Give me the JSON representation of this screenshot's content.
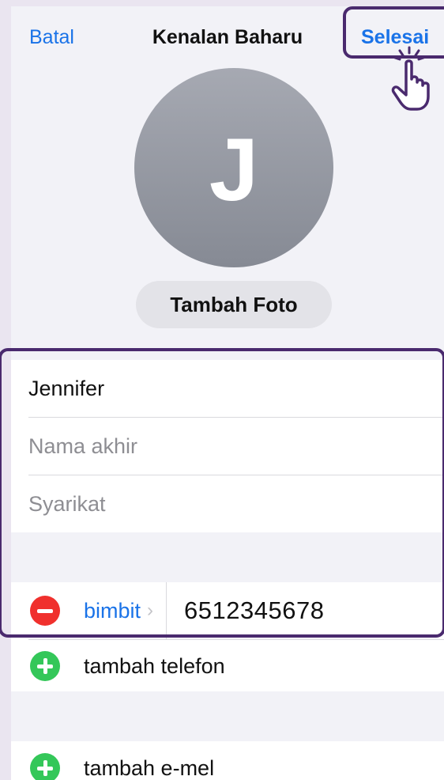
{
  "nav": {
    "cancel_label": "Batal",
    "title": "Kenalan Baharu",
    "done_label": "Selesai"
  },
  "avatar": {
    "initial": "J"
  },
  "photo": {
    "add_label": "Tambah Foto"
  },
  "name_fields": {
    "first_name_value": "Jennifer",
    "last_name_placeholder": "Nama akhir",
    "company_placeholder": "Syarikat"
  },
  "phone": {
    "type_label": "bimbit",
    "chevron": "›",
    "number": "6512345678",
    "add_label": "tambah telefon"
  },
  "email": {
    "add_label": "tambah e-mel"
  },
  "colors": {
    "accent": "#1a73e8",
    "remove": "#f0302d",
    "add": "#34c759",
    "highlight": "#4a2a6e"
  },
  "icons": [
    "minus-circle-icon",
    "plus-circle-icon",
    "tap-hand-icon",
    "chevron-right-icon"
  ]
}
